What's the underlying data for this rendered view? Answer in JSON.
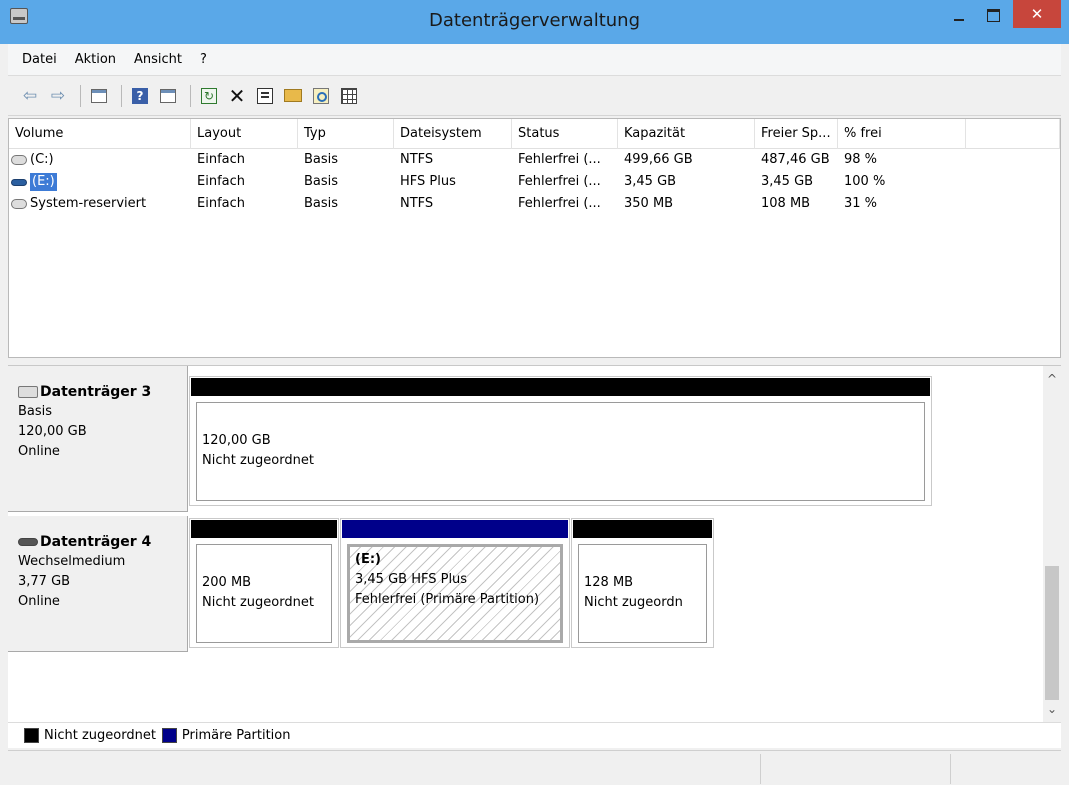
{
  "window": {
    "title": "Datenträgerverwaltung",
    "close_glyph": "✕",
    "accent": "#5aa8e8",
    "close_color": "#c7463c"
  },
  "menu": [
    "Datei",
    "Aktion",
    "Ansicht",
    "?"
  ],
  "toolbar": {
    "icons": [
      "back-icon",
      "forward-icon",
      "show-hide-console-tree-icon",
      "help-icon",
      "show-action-pane-icon",
      "refresh-icon",
      "delete-icon",
      "properties-icon",
      "open-icon",
      "explore-icon",
      "export-list-icon"
    ]
  },
  "volume_list": {
    "columns": [
      "Volume",
      "Layout",
      "Typ",
      "Dateisystem",
      "Status",
      "Kapazität",
      "Freier Sp...",
      "% frei"
    ],
    "rows": [
      {
        "volume": "(C:)",
        "layout": "Einfach",
        "typ": "Basis",
        "fs": "NTFS",
        "status": "Fehlerfrei (...",
        "kap": "499,66 GB",
        "frei": "487,46 GB",
        "pct": "98 %"
      },
      {
        "volume": "(E:)",
        "layout": "Einfach",
        "typ": "Basis",
        "fs": "HFS Plus",
        "status": "Fehlerfrei (...",
        "kap": "3,45 GB",
        "frei": "3,45 GB",
        "pct": "100 %"
      },
      {
        "volume": "System-reserviert",
        "layout": "Einfach",
        "typ": "Basis",
        "fs": "NTFS",
        "status": "Fehlerfrei (...",
        "kap": "350 MB",
        "frei": "108 MB",
        "pct": "31 %"
      }
    ]
  },
  "disks": [
    {
      "name": "Datenträger 3",
      "type": "Basis",
      "size": "120,00 GB",
      "state": "Online",
      "partitions": [
        {
          "size": "120,00 GB",
          "desc": "Nicht zugeordnet"
        }
      ]
    },
    {
      "name": "Datenträger 4",
      "type": "Wechselmedium",
      "size": "3,77 GB",
      "state": "Online",
      "partitions": [
        {
          "size": "200 MB",
          "desc": "Nicht zugeordnet"
        },
        {
          "label": "(E:)",
          "size": "3,45 GB HFS Plus",
          "desc": "Fehlerfrei (Primäre Partition)"
        },
        {
          "size": "128 MB",
          "desc": "Nicht zugeordn"
        }
      ]
    }
  ],
  "scrollbar": {
    "up": "^",
    "down": "⌄"
  },
  "legend": [
    {
      "label": "Nicht zugeordnet",
      "color": "#000000"
    },
    {
      "label": "Primäre Partition",
      "color": "#00008a"
    }
  ]
}
